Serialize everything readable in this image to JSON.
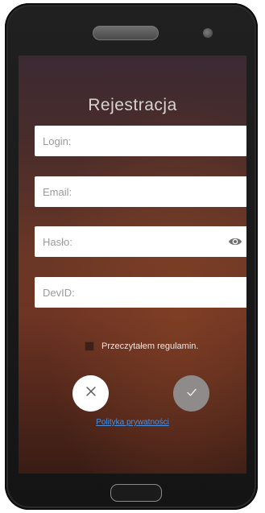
{
  "registration": {
    "title": "Rejestracja",
    "login_placeholder": "Login:",
    "email_placeholder": "Email:",
    "password_placeholder": "Hasło:",
    "devid_placeholder": "DevID:",
    "terms_label": "Przeczytałem regulamin.",
    "terms_checked": false,
    "cancel_icon": "close-icon",
    "confirm_icon": "check-icon",
    "show_password_icon": "eye-icon",
    "privacy_link": "Polityka prywatności"
  },
  "colors": {
    "link": "#4a8fe0",
    "confirm_button": "#8f8b8a",
    "cancel_button": "#ffffff"
  }
}
